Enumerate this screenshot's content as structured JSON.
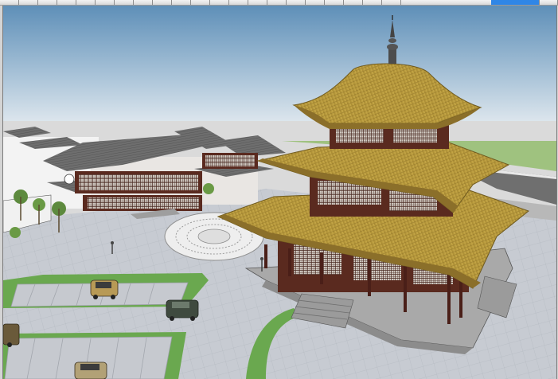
{
  "window": {
    "toolbar_buttons": 24,
    "active_button_color": "#2f86e6"
  },
  "viewport": {
    "scene": "3D model view",
    "colors": {
      "sky_top": "#5e8fb8",
      "sky_bottom": "#e6eef3",
      "ground": "#dcdcdc",
      "plaza_paving": "#c9cdd3",
      "grass": "#6aa84f",
      "roof_gold": "#b99b3e",
      "roof_dark": "#6d6d6d",
      "timber": "#5a2a1f"
    },
    "icons": [
      "pagoda-icon",
      "car-icon"
    ]
  }
}
